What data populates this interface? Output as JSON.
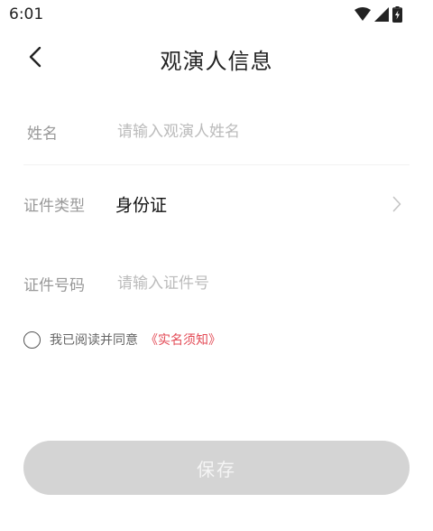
{
  "status_bar": {
    "time": "6:01",
    "icons": [
      "wifi-icon",
      "cellular-signal-icon",
      "battery-charging-icon"
    ]
  },
  "nav": {
    "title": "观演人信息",
    "back_icon": "chevron-left-icon"
  },
  "form": {
    "name": {
      "label": "姓名",
      "placeholder": "请输入观演人姓名",
      "value": ""
    },
    "id_type": {
      "label": "证件类型",
      "value": "身份证",
      "chevron_icon": "chevron-right-icon"
    },
    "id_number": {
      "label": "证件号码",
      "placeholder": "请输入证件号",
      "value": ""
    }
  },
  "agreement": {
    "text": "我已阅读并同意",
    "link": "《实名须知》",
    "checked": false
  },
  "save_button": {
    "label": "保存",
    "enabled": false
  },
  "colors": {
    "link": "#e34a55",
    "button_disabled_bg": "#d4d4d4",
    "label": "#999999",
    "placeholder": "#bbbbbb"
  }
}
